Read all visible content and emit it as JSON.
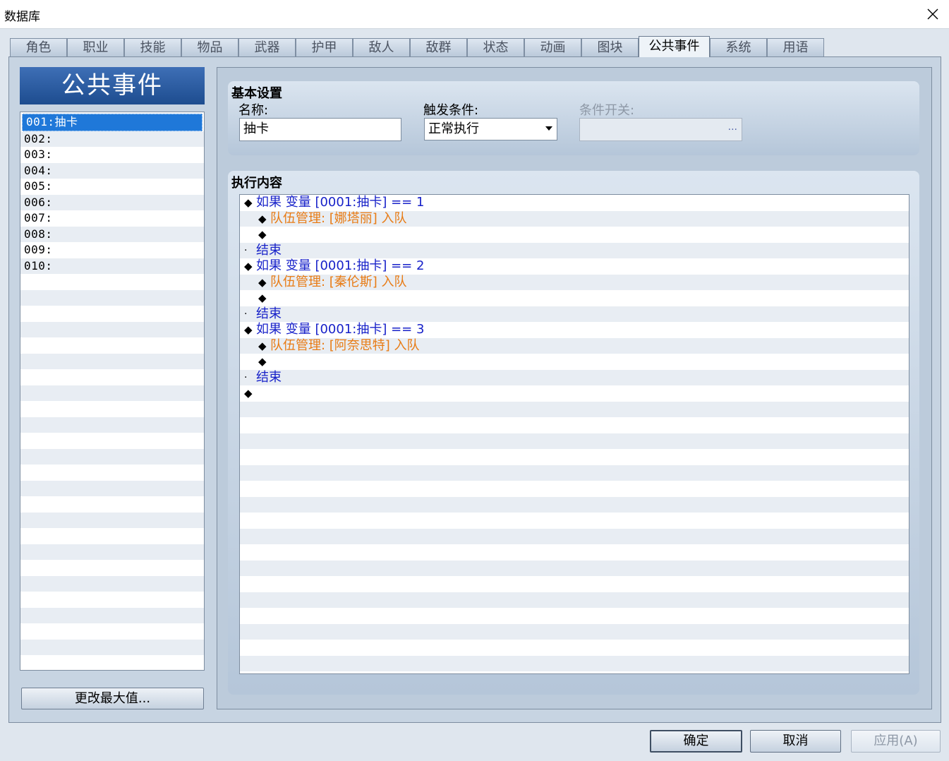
{
  "window": {
    "title": "数据库",
    "close_icon": "close-icon"
  },
  "tabs": [
    {
      "label": "角色"
    },
    {
      "label": "职业"
    },
    {
      "label": "技能"
    },
    {
      "label": "物品"
    },
    {
      "label": "武器"
    },
    {
      "label": "护甲"
    },
    {
      "label": "敌人"
    },
    {
      "label": "敌群"
    },
    {
      "label": "状态"
    },
    {
      "label": "动画"
    },
    {
      "label": "图块"
    },
    {
      "label": "公共事件",
      "active": true
    },
    {
      "label": "系统"
    },
    {
      "label": "用语"
    }
  ],
  "left": {
    "header": "公共事件",
    "items": [
      "001:抽卡",
      "002:",
      "003:",
      "004:",
      "005:",
      "006:",
      "007:",
      "008:",
      "009:",
      "010:"
    ],
    "selected_index": 0,
    "max_button": "更改最大值..."
  },
  "basic": {
    "title": "基本设置",
    "name_label": "名称:",
    "name_value": "抽卡",
    "trigger_label": "触发条件:",
    "trigger_value": "正常执行",
    "switch_label": "条件开关:",
    "switch_value": "",
    "switch_dots": "..."
  },
  "exec": {
    "title": "执行内容",
    "lines": [
      {
        "indent": 0,
        "marker": "◆",
        "text": "如果 变量 [0001:抽卡] == 1",
        "color": "blue"
      },
      {
        "indent": 1,
        "marker": "◆",
        "text": "队伍管理: [娜塔丽] 入队",
        "color": "orange"
      },
      {
        "indent": 1,
        "marker": "◆",
        "text": "",
        "color": "black"
      },
      {
        "indent": 0,
        "marker": "·",
        "text": "结束",
        "color": "blue"
      },
      {
        "indent": 0,
        "marker": "◆",
        "text": "如果 变量 [0001:抽卡] == 2",
        "color": "blue"
      },
      {
        "indent": 1,
        "marker": "◆",
        "text": "队伍管理: [秦伦斯] 入队",
        "color": "orange"
      },
      {
        "indent": 1,
        "marker": "◆",
        "text": "",
        "color": "black"
      },
      {
        "indent": 0,
        "marker": "·",
        "text": "结束",
        "color": "blue"
      },
      {
        "indent": 0,
        "marker": "◆",
        "text": "如果 变量 [0001:抽卡] == 3",
        "color": "blue"
      },
      {
        "indent": 1,
        "marker": "◆",
        "text": "队伍管理: [阿奈思特] 入队",
        "color": "orange"
      },
      {
        "indent": 1,
        "marker": "◆",
        "text": "",
        "color": "black"
      },
      {
        "indent": 0,
        "marker": "·",
        "text": "结束",
        "color": "blue"
      },
      {
        "indent": 0,
        "marker": "◆",
        "text": "",
        "color": "black"
      }
    ]
  },
  "buttons": {
    "ok": "确定",
    "cancel": "取消",
    "apply": "应用(A)"
  },
  "colors": {
    "accent": "#1f78d9",
    "blue_text": "#1822c9",
    "orange_text": "#e87b14"
  }
}
